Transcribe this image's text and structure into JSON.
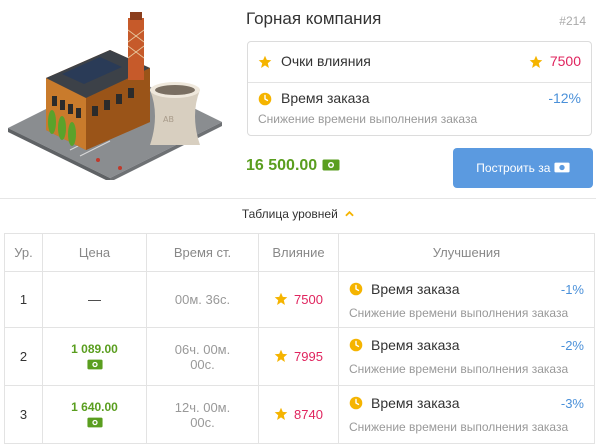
{
  "building": {
    "title": "Горная компания",
    "id": "#214",
    "illustration_icon": "mining-company-building-illustration"
  },
  "info": {
    "influence_label": "Очки влияния",
    "influence_value": "7500",
    "order_time_label": "Время заказа",
    "order_time_value": "-12%",
    "order_time_desc": "Снижение времени выполнения заказа"
  },
  "price": "16 500.00",
  "build_button_label": "Построить за",
  "levels_toggle_label": "Таблица уровней",
  "table": {
    "headers": [
      "Ур.",
      "Цена",
      "Время ст.",
      "Влияние",
      "Улучшения"
    ],
    "rows": [
      {
        "level": "1",
        "price": "—",
        "time_line1": "00м. 36с.",
        "time_line2": "",
        "influence": "7500",
        "upgrade_title": "Время заказа",
        "upgrade_value": "-1%",
        "upgrade_desc": "Снижение времени выполнения заказа"
      },
      {
        "level": "2",
        "price": "1 089.00",
        "time_line1": "06ч. 00м.",
        "time_line2": "00с.",
        "influence": "7995",
        "upgrade_title": "Время заказа",
        "upgrade_value": "-2%",
        "upgrade_desc": "Снижение времени выполнения заказа"
      },
      {
        "level": "3",
        "price": "1 640.00",
        "time_line1": "12ч. 00м.",
        "time_line2": "00с.",
        "influence": "8740",
        "upgrade_title": "Время заказа",
        "upgrade_value": "-3%",
        "upgrade_desc": "Снижение времени выполнения заказа"
      }
    ]
  },
  "colors": {
    "price_green": "#5a9e1f",
    "influence_pink": "#e0245e",
    "percent_blue": "#4a90d9",
    "button_blue": "#5b9ae0",
    "star_gold": "#f5b400"
  }
}
